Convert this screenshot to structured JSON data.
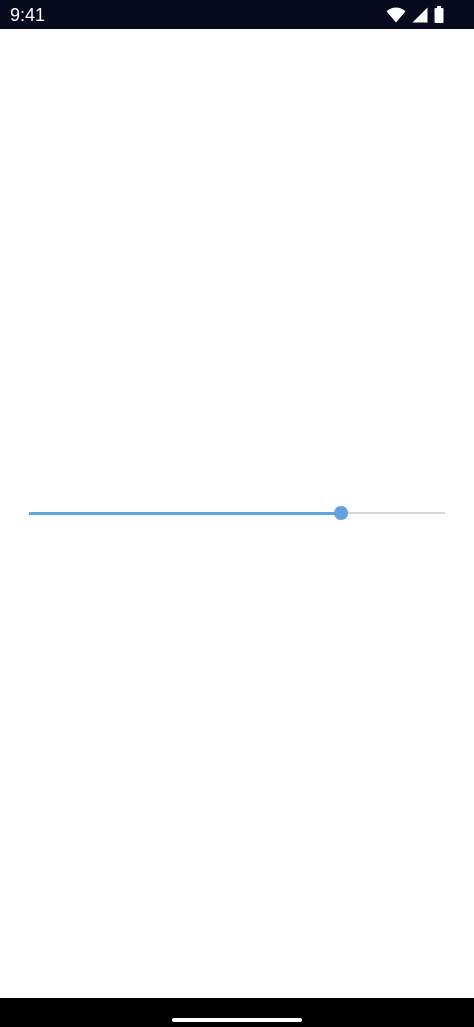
{
  "status_bar": {
    "time": "9:41",
    "icons": [
      "wifi-icon",
      "cell-signal-icon",
      "battery-icon"
    ],
    "background": "#050a1c"
  },
  "slider": {
    "value": 0.75,
    "min": 0,
    "max": 1,
    "active_color": "#62a3e3",
    "inactive_color": "#d6d6d6"
  },
  "nav_bar": {
    "background": "#000000"
  }
}
